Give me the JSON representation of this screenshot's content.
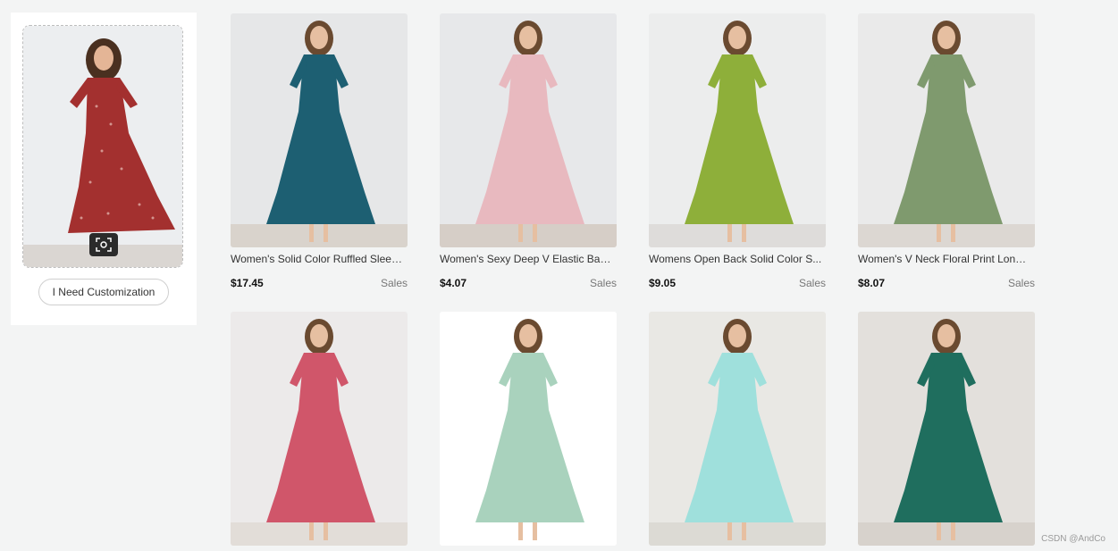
{
  "left_panel": {
    "customize_label": "I Need Customization",
    "query_image": {
      "dress_color": "#a3302f",
      "dot_color": "#f4d8d0",
      "bg": "#eceef0"
    }
  },
  "products": [
    {
      "title": "Women's Solid Color Ruffled Sleeve...",
      "price": "$17.45",
      "sales": "Sales",
      "dress_color": "#1d5f72",
      "bg": "#e6e7e8",
      "floor": "#d9d3cc"
    },
    {
      "title": "Women's Sexy Deep V Elastic Ban...",
      "price": "$4.07",
      "sales": "Sales",
      "dress_color": "#e8b9bf",
      "bg": "#e7e8ea",
      "floor": "#d6cec7"
    },
    {
      "title": "Womens Open Back Solid Color S...",
      "price": "$9.05",
      "sales": "Sales",
      "dress_color": "#8eaf3a",
      "bg": "#eceded",
      "floor": "#dedcda"
    },
    {
      "title": "Women's V Neck Floral Print Long ...",
      "price": "$8.07",
      "sales": "Sales",
      "dress_color": "#7f9a6e",
      "bg": "#eaeaea",
      "floor": "#dcd7d2"
    },
    {
      "title": "",
      "price": "",
      "sales": "",
      "dress_color": "#d0566a",
      "bg": "#eceaea",
      "floor": "#e2ddd8"
    },
    {
      "title": "",
      "price": "",
      "sales": "",
      "dress_color": "#a9d2bd",
      "bg": "#ffffff",
      "floor": "#ffffff"
    },
    {
      "title": "",
      "price": "",
      "sales": "",
      "dress_color": "#9fe0dc",
      "bg": "#e9e8e4",
      "floor": "#dcdad4"
    },
    {
      "title": "",
      "price": "",
      "sales": "",
      "dress_color": "#1f6e5e",
      "bg": "#e3e0dc",
      "floor": "#d7d2cc"
    }
  ],
  "watermark": "CSDN @AndCo"
}
